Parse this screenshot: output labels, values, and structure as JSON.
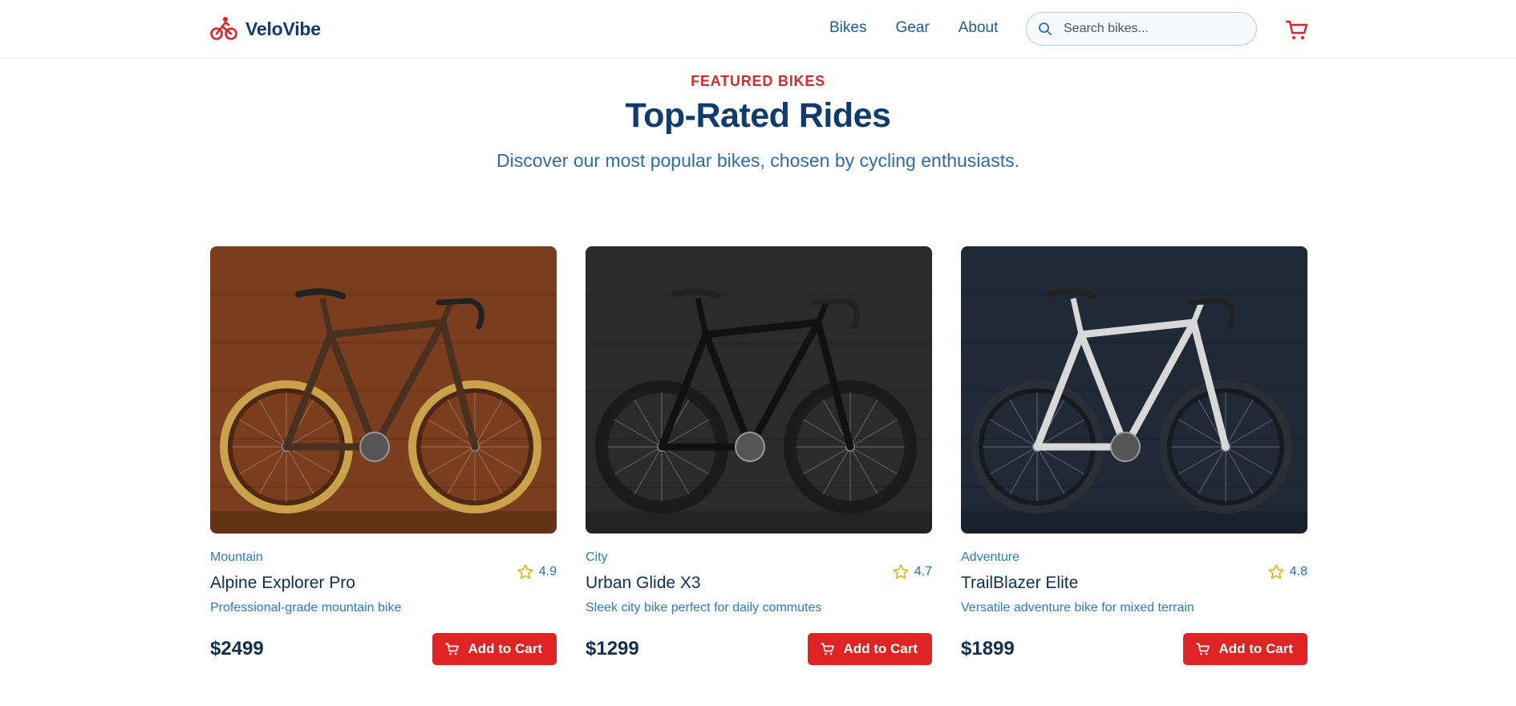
{
  "brand": {
    "name": "VeloVibe",
    "icon": "bicycle-icon",
    "accent": "#e02424",
    "primary": "#0f3b6e"
  },
  "nav": {
    "links": [
      "Bikes",
      "Gear",
      "About"
    ]
  },
  "search": {
    "placeholder": "Search bikes...",
    "value": "",
    "icon": "search-icon"
  },
  "cart": {
    "icon": "shopping-cart-icon"
  },
  "hero": {
    "eyebrow": "FEATURED BIKES",
    "title": "Top-Rated Rides",
    "subtitle": "Discover our most popular bikes, chosen by cycling enthusiasts."
  },
  "products": [
    {
      "category": "Mountain",
      "name": "Alpine Explorer Pro",
      "description": "Professional-grade mountain bike",
      "rating": "4.9",
      "price": "$2499",
      "button": "Add to Cart",
      "image": {
        "background": "#7a3d1d",
        "frame": "#4a3020",
        "rim": "#c9a24a"
      }
    },
    {
      "category": "City",
      "name": "Urban Glide X3",
      "description": "Sleek city bike perfect for daily commutes",
      "rating": "4.7",
      "price": "$1299",
      "button": "Add to Cart",
      "image": {
        "background": "#2b2b2b",
        "frame": "#111111",
        "rim": "#1a1a1a"
      }
    },
    {
      "category": "Adventure",
      "name": "TrailBlazer Elite",
      "description": "Versatile adventure bike for mixed terrain",
      "rating": "4.8",
      "price": "$1899",
      "button": "Add to Cart",
      "image": {
        "background": "#1f2a36",
        "frame": "#d8d8d8",
        "rim": "#2a2f36"
      }
    }
  ]
}
